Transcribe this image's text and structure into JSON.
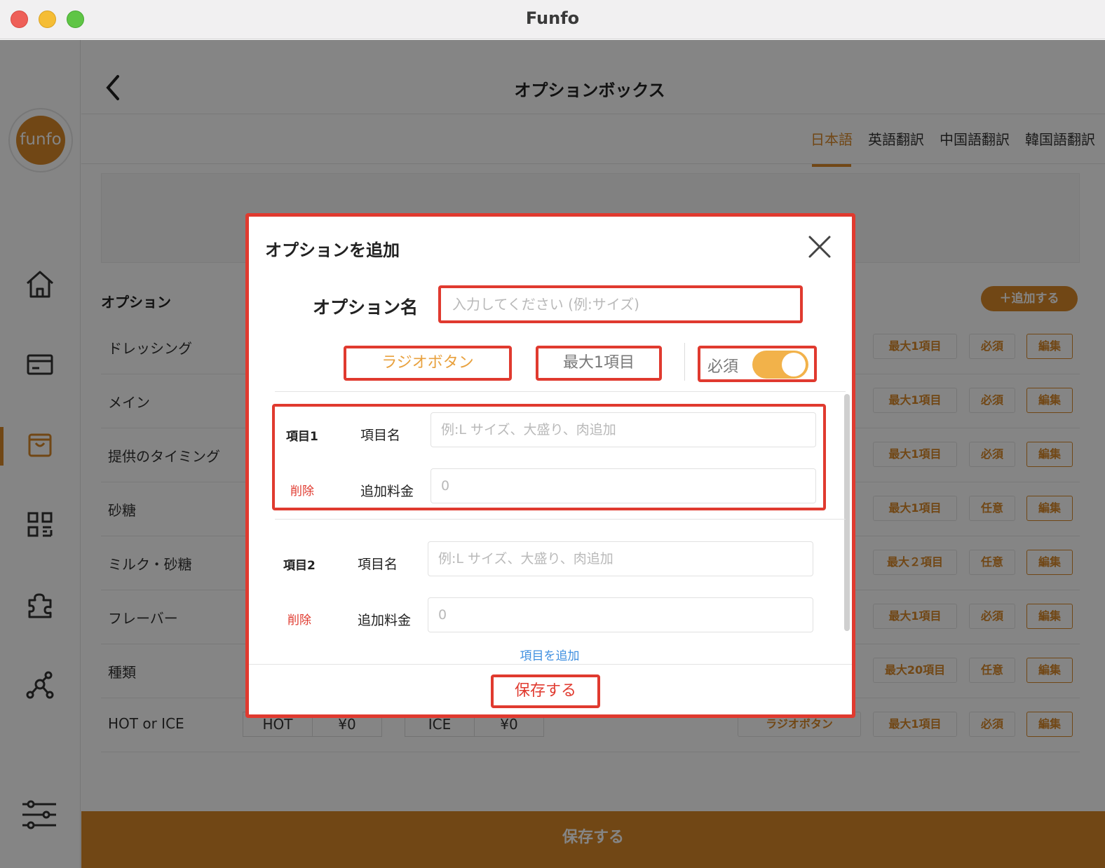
{
  "window": {
    "title": "Funfo"
  },
  "sidebar": {
    "logo_text": "funfo",
    "items": [
      {
        "icon": "home-icon"
      },
      {
        "icon": "card-icon"
      },
      {
        "icon": "shopping-bag-icon",
        "active": true
      },
      {
        "icon": "qr-code-icon"
      },
      {
        "icon": "puzzle-icon"
      },
      {
        "icon": "network-icon"
      },
      {
        "icon": "sliders-icon"
      }
    ]
  },
  "header": {
    "title": "オプションボックス",
    "lang_tabs": [
      "日本語",
      "英語翻訳",
      "中国語翻訳",
      "韓国語翻訳"
    ],
    "active_lang": "日本語"
  },
  "options": {
    "heading": "オプション",
    "add_button": "＋追加する",
    "rows": [
      {
        "name": "ドレッシング",
        "max": "最大1項目",
        "req": "必須",
        "edit": "編集"
      },
      {
        "name": "メイン",
        "max": "最大1項目",
        "req": "必須",
        "edit": "編集"
      },
      {
        "name": "提供のタイミング",
        "max": "最大1項目",
        "req": "必須",
        "edit": "編集"
      },
      {
        "name": "砂糖",
        "max": "最大1項目",
        "req": "任意",
        "edit": "編集"
      },
      {
        "name": "ミルク・砂糖",
        "max": "最大２項目",
        "req": "任意",
        "edit": "編集"
      },
      {
        "name": "フレーバー",
        "max": "最大1項目",
        "req": "必須",
        "edit": "編集"
      },
      {
        "name": "種類",
        "max": "最大20項目",
        "req": "任意",
        "edit": "編集"
      },
      {
        "name": "HOT or ICE",
        "max": "最大1項目",
        "req": "必須",
        "edit": "編集",
        "kind": "ラジオボタン",
        "values": [
          "HOT",
          "¥0",
          "ICE",
          "¥0"
        ]
      }
    ]
  },
  "footer": {
    "save_label": "保存する"
  },
  "modal": {
    "title": "オプションを追加",
    "name_label": "オプション名",
    "name_placeholder": "入力してください (例:サイズ)",
    "type_label": "ラジオボタン",
    "max_label": "最大1項目",
    "required_label": "必須",
    "required_on": true,
    "items": [
      {
        "no": "項目1",
        "delete": "削除",
        "name_label": "項目名",
        "name_placeholder": "例:L サイズ、大盛り、肉追加",
        "price_label": "追加料金",
        "price_placeholder": "0"
      },
      {
        "no": "項目2",
        "delete": "削除",
        "name_label": "項目名",
        "name_placeholder": "例:L サイズ、大盛り、肉追加",
        "price_label": "追加料金",
        "price_placeholder": "0"
      }
    ],
    "add_item": "項目を追加",
    "save": "保存する"
  },
  "colors": {
    "accent": "#d9892a",
    "highlight": "#e03a2f",
    "link": "#3f8fe0"
  }
}
